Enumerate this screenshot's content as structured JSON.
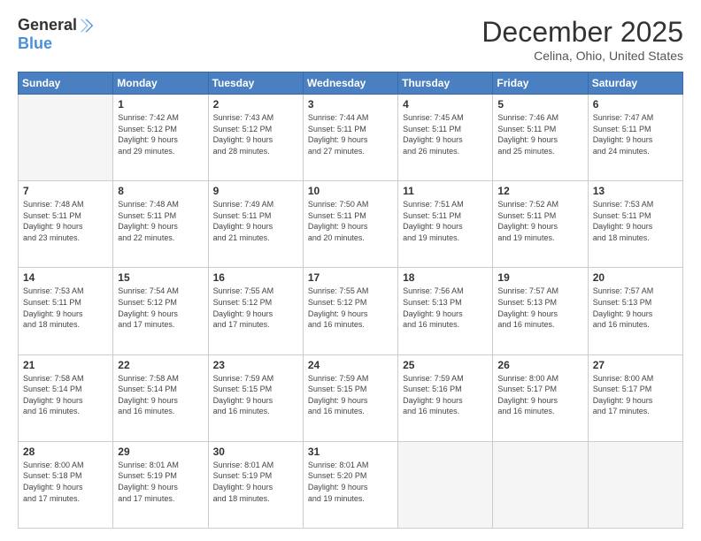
{
  "header": {
    "logo_general": "General",
    "logo_blue": "Blue",
    "month_title": "December 2025",
    "location": "Celina, Ohio, United States"
  },
  "weekdays": [
    "Sunday",
    "Monday",
    "Tuesday",
    "Wednesday",
    "Thursday",
    "Friday",
    "Saturday"
  ],
  "weeks": [
    [
      {
        "day": "",
        "info": ""
      },
      {
        "day": "1",
        "info": "Sunrise: 7:42 AM\nSunset: 5:12 PM\nDaylight: 9 hours\nand 29 minutes."
      },
      {
        "day": "2",
        "info": "Sunrise: 7:43 AM\nSunset: 5:12 PM\nDaylight: 9 hours\nand 28 minutes."
      },
      {
        "day": "3",
        "info": "Sunrise: 7:44 AM\nSunset: 5:11 PM\nDaylight: 9 hours\nand 27 minutes."
      },
      {
        "day": "4",
        "info": "Sunrise: 7:45 AM\nSunset: 5:11 PM\nDaylight: 9 hours\nand 26 minutes."
      },
      {
        "day": "5",
        "info": "Sunrise: 7:46 AM\nSunset: 5:11 PM\nDaylight: 9 hours\nand 25 minutes."
      },
      {
        "day": "6",
        "info": "Sunrise: 7:47 AM\nSunset: 5:11 PM\nDaylight: 9 hours\nand 24 minutes."
      }
    ],
    [
      {
        "day": "7",
        "info": "Sunrise: 7:48 AM\nSunset: 5:11 PM\nDaylight: 9 hours\nand 23 minutes."
      },
      {
        "day": "8",
        "info": "Sunrise: 7:48 AM\nSunset: 5:11 PM\nDaylight: 9 hours\nand 22 minutes."
      },
      {
        "day": "9",
        "info": "Sunrise: 7:49 AM\nSunset: 5:11 PM\nDaylight: 9 hours\nand 21 minutes."
      },
      {
        "day": "10",
        "info": "Sunrise: 7:50 AM\nSunset: 5:11 PM\nDaylight: 9 hours\nand 20 minutes."
      },
      {
        "day": "11",
        "info": "Sunrise: 7:51 AM\nSunset: 5:11 PM\nDaylight: 9 hours\nand 19 minutes."
      },
      {
        "day": "12",
        "info": "Sunrise: 7:52 AM\nSunset: 5:11 PM\nDaylight: 9 hours\nand 19 minutes."
      },
      {
        "day": "13",
        "info": "Sunrise: 7:53 AM\nSunset: 5:11 PM\nDaylight: 9 hours\nand 18 minutes."
      }
    ],
    [
      {
        "day": "14",
        "info": "Sunrise: 7:53 AM\nSunset: 5:11 PM\nDaylight: 9 hours\nand 18 minutes."
      },
      {
        "day": "15",
        "info": "Sunrise: 7:54 AM\nSunset: 5:12 PM\nDaylight: 9 hours\nand 17 minutes."
      },
      {
        "day": "16",
        "info": "Sunrise: 7:55 AM\nSunset: 5:12 PM\nDaylight: 9 hours\nand 17 minutes."
      },
      {
        "day": "17",
        "info": "Sunrise: 7:55 AM\nSunset: 5:12 PM\nDaylight: 9 hours\nand 16 minutes."
      },
      {
        "day": "18",
        "info": "Sunrise: 7:56 AM\nSunset: 5:13 PM\nDaylight: 9 hours\nand 16 minutes."
      },
      {
        "day": "19",
        "info": "Sunrise: 7:57 AM\nSunset: 5:13 PM\nDaylight: 9 hours\nand 16 minutes."
      },
      {
        "day": "20",
        "info": "Sunrise: 7:57 AM\nSunset: 5:13 PM\nDaylight: 9 hours\nand 16 minutes."
      }
    ],
    [
      {
        "day": "21",
        "info": "Sunrise: 7:58 AM\nSunset: 5:14 PM\nDaylight: 9 hours\nand 16 minutes."
      },
      {
        "day": "22",
        "info": "Sunrise: 7:58 AM\nSunset: 5:14 PM\nDaylight: 9 hours\nand 16 minutes."
      },
      {
        "day": "23",
        "info": "Sunrise: 7:59 AM\nSunset: 5:15 PM\nDaylight: 9 hours\nand 16 minutes."
      },
      {
        "day": "24",
        "info": "Sunrise: 7:59 AM\nSunset: 5:15 PM\nDaylight: 9 hours\nand 16 minutes."
      },
      {
        "day": "25",
        "info": "Sunrise: 7:59 AM\nSunset: 5:16 PM\nDaylight: 9 hours\nand 16 minutes."
      },
      {
        "day": "26",
        "info": "Sunrise: 8:00 AM\nSunset: 5:17 PM\nDaylight: 9 hours\nand 16 minutes."
      },
      {
        "day": "27",
        "info": "Sunrise: 8:00 AM\nSunset: 5:17 PM\nDaylight: 9 hours\nand 17 minutes."
      }
    ],
    [
      {
        "day": "28",
        "info": "Sunrise: 8:00 AM\nSunset: 5:18 PM\nDaylight: 9 hours\nand 17 minutes."
      },
      {
        "day": "29",
        "info": "Sunrise: 8:01 AM\nSunset: 5:19 PM\nDaylight: 9 hours\nand 17 minutes."
      },
      {
        "day": "30",
        "info": "Sunrise: 8:01 AM\nSunset: 5:19 PM\nDaylight: 9 hours\nand 18 minutes."
      },
      {
        "day": "31",
        "info": "Sunrise: 8:01 AM\nSunset: 5:20 PM\nDaylight: 9 hours\nand 19 minutes."
      },
      {
        "day": "",
        "info": ""
      },
      {
        "day": "",
        "info": ""
      },
      {
        "day": "",
        "info": ""
      }
    ]
  ]
}
